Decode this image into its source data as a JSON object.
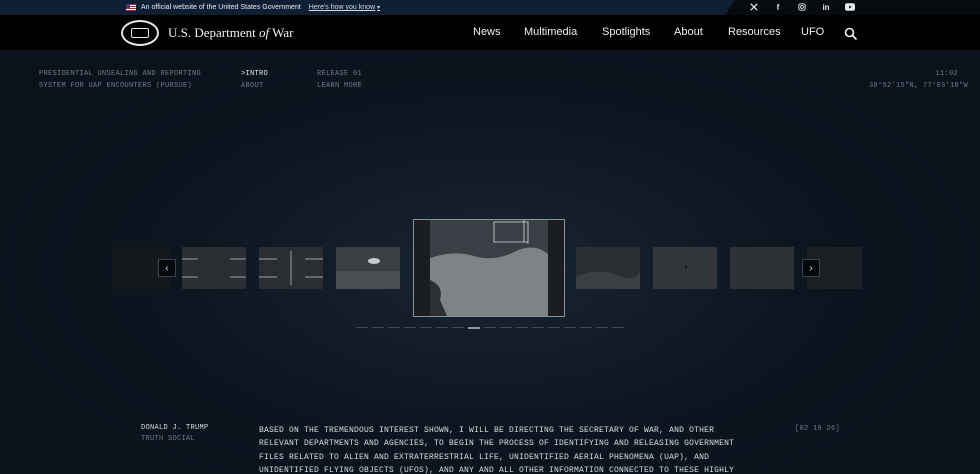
{
  "gov_banner": {
    "official_text": "An official website of the United States Government",
    "how_text": "Here's how you know",
    "social_icons": [
      "x-icon",
      "facebook-icon",
      "instagram-icon",
      "linkedin-icon",
      "youtube-icon"
    ]
  },
  "header": {
    "title_prefix": "U.S. Department ",
    "title_of": "of",
    "title_suffix": " War",
    "nav": [
      "News",
      "Multimedia",
      "Spotlights",
      "About",
      "Resources",
      "UFO"
    ]
  },
  "pursue": {
    "title_line1": "PRESIDENTIAL UNSEALING AND REPORTING",
    "title_line2": "SYSTEM FOR UAP ENCOUNTERS (PURSUE)",
    "menu1": [
      ">INTRO",
      "ABOUT"
    ],
    "menu2": [
      "RELEASE 01",
      "LEARN MORE"
    ],
    "time": "11:02",
    "coords": "38°52′15″N, 77°03′18″W"
  },
  "carousel": {
    "prev_label": "‹",
    "next_label": "›",
    "dot_count": 17,
    "active_dot": 7
  },
  "post": {
    "author": "DONALD J. TRUMP",
    "source": "TRUTH SOCIAL",
    "date": "[02 19 26]",
    "lines": [
      "BASED ON THE TREMENDOUS INTEREST SHOWN, I WILL BE DIRECTING THE SECRETARY OF WAR, AND OTHER",
      "RELEVANT DEPARTMENTS AND AGENCIES, TO BEGIN THE PROCESS OF IDENTIFYING AND RELEASING GOVERNMENT",
      "FILES RELATED TO ALIEN AND EXTRATERRESTRIAL LIFE, UNIDENTIFIED AERIAL PHENOMENA (UAP), AND",
      "UNIDENTIFIED FLYING OBJECTS (UFOS), AND ANY AND ALL OTHER INFORMATION CONNECTED TO THESE HIGHLY"
    ]
  },
  "colors": {
    "background": "#0a121c",
    "nav_bg": "#000000",
    "banner_bg": "#0f1f33",
    "muted_text": "#6f7c8b"
  }
}
